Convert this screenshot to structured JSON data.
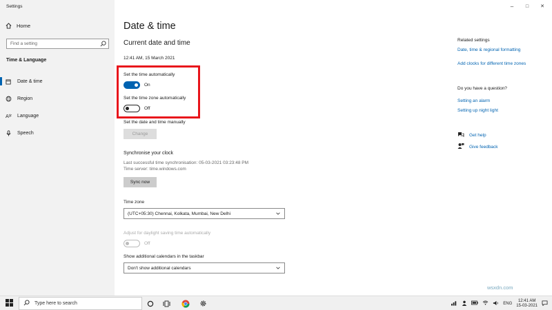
{
  "window": {
    "title": "Settings",
    "controls": {
      "minimize": "–",
      "maximize": "□",
      "close": "✕"
    }
  },
  "sidebar": {
    "home_label": "Home",
    "search_placeholder": "Find a setting",
    "section_label": "Time & Language",
    "items": [
      {
        "label": "Date & time",
        "icon": "calendar-clock-icon",
        "active": true
      },
      {
        "label": "Region",
        "icon": "globe-icon",
        "active": false
      },
      {
        "label": "Language",
        "icon": "language-icon",
        "active": false
      },
      {
        "label": "Speech",
        "icon": "microphone-icon",
        "active": false
      }
    ]
  },
  "main": {
    "page_title": "Date & time",
    "section_title": "Current date and time",
    "current_datetime": "12:41 AM, 15 March 2021",
    "auto_time": {
      "label": "Set the time automatically",
      "state": "On"
    },
    "auto_timezone": {
      "label": "Set the time zone automatically",
      "state": "Off"
    },
    "manual": {
      "label": "Set the date and time manually",
      "button": "Change"
    },
    "sync": {
      "heading": "Synchronise your clock",
      "last_sync": "Last successful time synchronisation: 05-03-2021 03:23:48 PM",
      "server": "Time server: time.windows.com",
      "button": "Sync now"
    },
    "timezone": {
      "label": "Time zone",
      "value": "(UTC+05:30) Chennai, Kolkata, Mumbai, New Delhi"
    },
    "dst": {
      "label": "Adjust for daylight saving time automatically",
      "state": "Off"
    },
    "calendars": {
      "label": "Show additional calendars in the taskbar",
      "value": "Don't show additional calendars"
    }
  },
  "related": {
    "heading": "Related settings",
    "links": [
      "Date, time & regional formatting",
      "Add clocks for different time zones"
    ],
    "question_heading": "Do you have a question?",
    "question_links": [
      "Setting an alarm",
      "Setting up night light"
    ],
    "get_help": "Get help",
    "give_feedback": "Give feedback"
  },
  "watermark": "wsxdn.com",
  "taskbar": {
    "search_placeholder": "Type here to search",
    "language": "ENG",
    "time": "12:41 AM",
    "date": "15-03-2021"
  },
  "colors": {
    "accent": "#0063b1",
    "highlight": "#e8141b"
  }
}
